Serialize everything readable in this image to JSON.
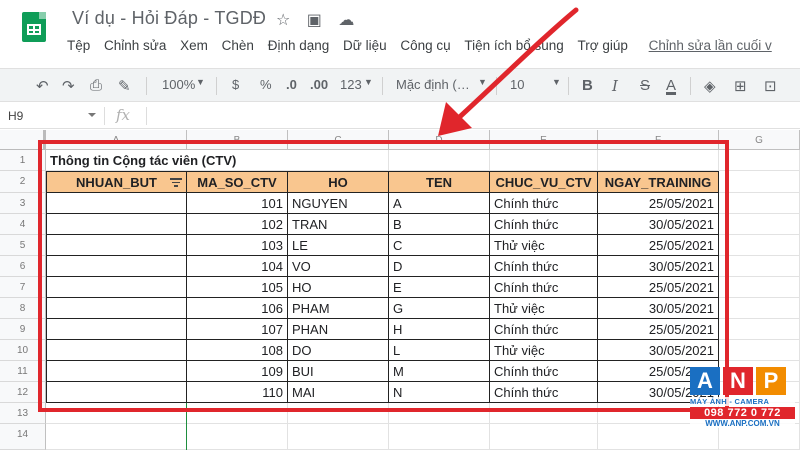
{
  "app": {
    "doc_title": "Ví dụ - Hỏi Đáp - TGDĐ",
    "title_icons": [
      "star-icon",
      "folder-move-icon",
      "cloud-status-icon"
    ]
  },
  "menu": {
    "items": [
      "Tệp",
      "Chỉnh sửa",
      "Xem",
      "Chèn",
      "Định dạng",
      "Dữ liệu",
      "Công cụ",
      "Tiện ích bổ sung",
      "Trợ giúp"
    ],
    "last_edit": "Chỉnh sửa lần cuối v"
  },
  "toolbar": {
    "zoom": "100%",
    "currency": "$",
    "percent": "%",
    "dec_decrease": ".0",
    "dec_increase": ".00",
    "more_formats": "123",
    "font": "Mặc định (…",
    "font_size": "10",
    "bold": "B",
    "italic": "I",
    "strike": "S",
    "text_color": "A"
  },
  "formula_bar": {
    "name_box": "H9",
    "fx": "fx",
    "value": ""
  },
  "column_headers": [
    "A",
    "B",
    "C",
    "D",
    "E",
    "F",
    "G"
  ],
  "row_headers": [
    "1",
    "2",
    "3",
    "4",
    "5",
    "6",
    "7",
    "8",
    "9",
    "10",
    "11",
    "12",
    "13",
    "14"
  ],
  "sheet": {
    "title": "Thông tin Cộng tác viên (CTV)",
    "headers": [
      "NHUAN_BUT",
      "MA_SO_CTV",
      "HO",
      "TEN",
      "CHUC_VU_CTV",
      "NGAY_TRAINING"
    ],
    "rows": [
      [
        "",
        "101",
        "NGUYEN",
        "A",
        "Chính thức",
        "25/05/2021"
      ],
      [
        "",
        "102",
        "TRAN",
        "B",
        "Chính thức",
        "30/05/2021"
      ],
      [
        "",
        "103",
        "LE",
        "C",
        "Thử việc",
        "25/05/2021"
      ],
      [
        "",
        "104",
        "VO",
        "D",
        "Chính thức",
        "30/05/2021"
      ],
      [
        "",
        "105",
        "HO",
        "E",
        "Chính thức",
        "25/05/2021"
      ],
      [
        "",
        "106",
        "PHAM",
        "G",
        "Thử việc",
        "30/05/2021"
      ],
      [
        "",
        "107",
        "PHAN",
        "H",
        "Chính thức",
        "25/05/2021"
      ],
      [
        "",
        "108",
        "DO",
        "L",
        "Thử việc",
        "30/05/2021"
      ],
      [
        "",
        "109",
        "BUI",
        "M",
        "Chính thức",
        "25/05/2021"
      ],
      [
        "",
        "110",
        "MAI",
        "N",
        "Chính thức",
        "30/05/2021"
      ]
    ]
  },
  "colors": {
    "header_fill": "#f9c68f",
    "annotation_red": "#e0262c",
    "sheets_green": "#0f9d58"
  },
  "watermark": {
    "letters": [
      "A",
      "N",
      "P"
    ],
    "line": "MÁY ẢNH - CAMERA",
    "phone": "098 772 0 772",
    "web": "WWW.ANP.COM.VN"
  }
}
